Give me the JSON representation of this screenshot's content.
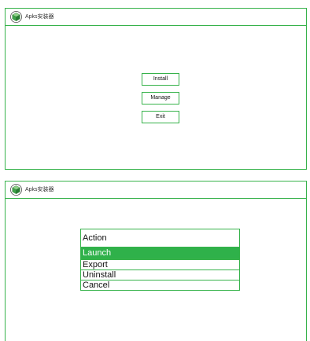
{
  "app": {
    "title": "Apks安装器",
    "icon": "green-cube-logo",
    "accent_color": "#36b24a"
  },
  "top_screen": {
    "buttons": {
      "install": "Install",
      "manage": "Manage",
      "exit": "Exit"
    }
  },
  "bottom_screen": {
    "menu": {
      "header": "Action",
      "items": [
        {
          "label": "Launch",
          "selected": true
        },
        {
          "label": "Export",
          "selected": false
        },
        {
          "label": "Uninstall",
          "selected": false
        },
        {
          "label": "Cancel",
          "selected": false
        }
      ],
      "selected_color": "#2fb14a"
    }
  }
}
